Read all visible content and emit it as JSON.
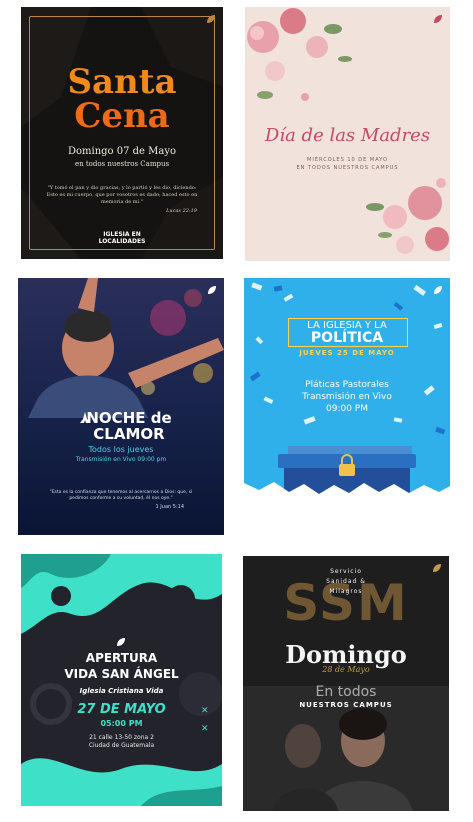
{
  "cards": [
    {
      "title_1": "Santa",
      "title_2": "Cena",
      "date": "Domingo 07 de Mayo",
      "subtitle": "en todos nuestros Campus",
      "quote": "\"Y tomó el pan y dio gracias, y lo partió y les dio, diciendo: Esto es mi cuerpo, que por vosotros es dado; haced esto en memoria de mí.\"",
      "reference": "Lucas 22:19",
      "logo_line_1": "IGLESIA EN",
      "logo_line_2": "LOCALIDADES"
    },
    {
      "title": "Día de las Madres",
      "line_1": "MIÉRCOLES 10 DE MAYO",
      "line_2": "EN TODOS NUESTROS CAMPUS"
    },
    {
      "title_1": "NOCHE de",
      "title_2": "CLAMOR",
      "schedule_1": "Todos los jueves",
      "schedule_2": "Transmisión en Vivo 09:00 pm",
      "verse": "\"Esta es la confianza que tenemos al acercarnos a Dios: que, si pedimos conforme a su voluntad, él nos oye.\"",
      "verse_ref": "1 Juan 5:14"
    },
    {
      "heading_1": "LA IGLESIA Y LA",
      "heading_2": "POLÍTICA",
      "date": "JUEVES 25 DE MAYO",
      "line_1": "Pláticas Pastorales",
      "line_2": "Transmisión en Vivo",
      "line_3": "09:00 PM"
    },
    {
      "title_1": "APERTURA",
      "title_2": "VIDA SAN ÁNGEL",
      "church": "Iglesia Cristiana Vida",
      "date": "27 DE MAYO",
      "time": "05:00 PM",
      "address_1": "21 calle 13-50 zona 2",
      "address_2": "Ciudad de Guatemala"
    },
    {
      "big": "SSM",
      "service_1": "Servicio",
      "service_2": "Sanidad &",
      "service_3": "Milagros",
      "title": "Domingo",
      "date": "28 de Mayo",
      "en": "En todos",
      "campus": "NUESTROS CAMPUS"
    }
  ],
  "colors": {
    "gold": "#b8893e",
    "orange": "#f08a1a",
    "pink": "#c24a6a",
    "cyan": "#4fd3e8",
    "sky": "#2fb0ea",
    "yellow": "#ffd34a",
    "teal": "#3fe0c8",
    "bronze": "#c59a4a"
  },
  "icons": [
    "leaf-icon",
    "praying-hands-icon",
    "padlock-icon",
    "close-x-icon"
  ]
}
